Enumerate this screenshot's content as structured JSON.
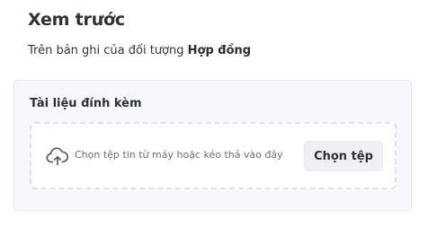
{
  "header": {
    "title": "Xem trước",
    "subtitle_prefix": "Trên bản ghi của đối tượng ",
    "subtitle_entity": "Hợp đồng"
  },
  "attachment": {
    "label": "Tài liệu đính kèm",
    "dropzone_hint": "Chọn tệp tin từ máy hoặc kéo thả vào đây",
    "choose_button": "Chọn tệp",
    "icon": "cloud-upload-icon"
  }
}
